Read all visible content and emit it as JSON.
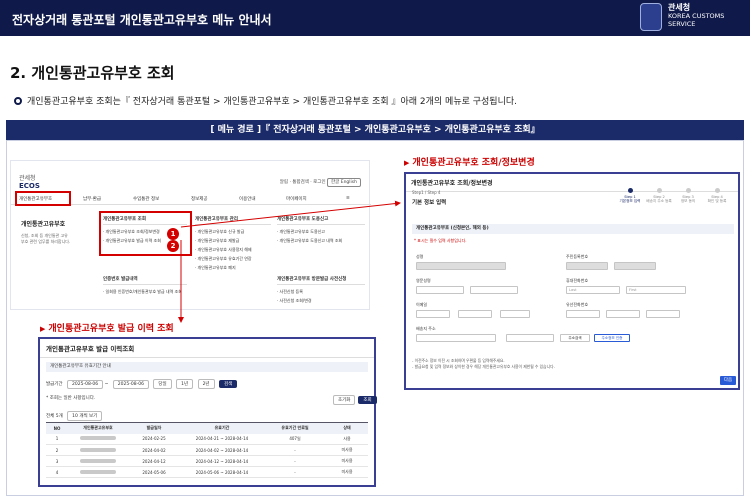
{
  "banner": {
    "title": "전자상거래 통관포털 개인통관고유부호 메뉴 안내서",
    "logo_ko": "관세청",
    "logo_en_1": "KOREA CUSTOMS",
    "logo_en_2": "SERVICE"
  },
  "section": {
    "title": "2. 개인통관고유부호 조회",
    "intro": "개인통관고유부호 조회는『 전자상거래 통관포털 > 개인통관고유부호 > 개인통관고유부호 조회 』아래 2개의 메뉴로 구성됩니다."
  },
  "route": "[ 메뉴 경로 ]『 전자상거래 통관포털 > 개인통관고유부호 > 개인통관고유부호 조회』",
  "ecos": {
    "logo_ko": "관세청",
    "logo_en": "ECOS",
    "util": [
      "알림",
      "통합검색",
      "로그인"
    ],
    "lang": "한글  English",
    "nav": [
      "개인통관고유부호",
      "납부·환급",
      "수입통관 정보",
      "정보제공",
      "이용안내",
      "마이페이지",
      "≡"
    ],
    "side_title": "개인통관고유부호",
    "side_note": "신청, 조회 등 개인통관 고유부호 관련 업무를 처리합니다.",
    "col1_title": "개인통관고유부호 조회",
    "col1_items": [
      "개인통관고유부호 조회/정보변경",
      "개인통관고유부호 발급 이력 조회"
    ],
    "col2_title": "개인통관고유부호 관리",
    "col2_items": [
      "개인통관고유부호 신규 발급",
      "개인통관고유부호 재발급",
      "개인통관고유부호 사용정지 해제",
      "개인통관고유부호 유효기간 연장",
      "개인통관고유부호 폐지"
    ],
    "col3_title": "개인통관고유부호 도용신고",
    "col3_items": [
      "개인통관고유부호 도용신고",
      "개인통관고유부호 도용신고 내역 조회"
    ],
    "col4_title": "인증번호 발급내역",
    "col4_items": [
      "일회용 인증번호/개인통관부호 발급 내역 조회"
    ],
    "col5_title": "개인통관고유부호 방문발급 사전신청",
    "col5_items": [
      "사전신청 등록",
      "사전신청 조회/변경"
    ],
    "badge1": "1",
    "badge2": "2"
  },
  "label_change": "개인통관고유부호 조회/정보변경",
  "label_history": "개인통관고유부호 발급 이력 조회",
  "history": {
    "title": "개인통관고유부호 발급 이력조회",
    "bar": "개인통관고유부호 유효기간 안내",
    "period_label": "발급기간",
    "date_from": "2025-08-06",
    "date_to": "2025-08-06",
    "quick": [
      "당일",
      "1년",
      "2년"
    ],
    "search_btn": "검색",
    "note": "조회는 일반 사항입니다.",
    "reset": "초기화",
    "query": "조회",
    "count": "전체 5개",
    "page_size": "10 개씩 보기",
    "headers": [
      "NO",
      "개인통관고유부호",
      "발급일자",
      "유효기간",
      "유효기간 만료일",
      "상태"
    ],
    "rows": [
      {
        "no": "1",
        "issued": "2024-02-25",
        "valid": "2024-04-21 ~ 2028-04-14",
        "expire": "407일",
        "status": "사용"
      },
      {
        "no": "2",
        "issued": "2024-04-02",
        "valid": "2024-04-02 ~ 2028-04-14",
        "expire": "-",
        "status": "미사용"
      },
      {
        "no": "3",
        "issued": "2024-04-12",
        "valid": "2024-04-12 ~ 2028-04-14",
        "expire": "-",
        "status": "미사용"
      },
      {
        "no": "4",
        "issued": "2024-05-06",
        "valid": "2024-05-06 ~ 2028-04-14",
        "expire": "-",
        "status": "미사용"
      }
    ]
  },
  "change": {
    "title": "개인통관고유부호 조회/정보변경",
    "step_small": "Step1 / Step 4",
    "subtitle": "기본 정보 입력",
    "steps": [
      {
        "n": "Step 1",
        "t": "기본정보 입력"
      },
      {
        "n": "Step 2",
        "t": "배송지 주소 등록"
      },
      {
        "n": "Step 3",
        "t": "정보 동의"
      },
      {
        "n": "Step 4",
        "t": "확인 및 등록"
      }
    ],
    "section_label": "개인통관고유부호 (신청본인, 해외 등)",
    "required_note": "표시는 필수 입력 사항입니다.",
    "fields": {
      "name": "성명",
      "personal": "주민등록번호",
      "eng_name": "영문성명",
      "phone": "휴대전화번호",
      "email": "이메일",
      "landline": "유선전화번호",
      "address": "배송지 주소",
      "last": "Last",
      "first": "First",
      "addr_search": "주소검색",
      "addr_verify": "주소정보 인증"
    },
    "notes": [
      "- 이전주소 정보 이전 시 조회하며 우편물 등 입력해주세요.",
      "- 발급요청 및 입력 정보와 상이한 경우 해당 개인통관고유부호 사용이 제한될 수 있습니다."
    ],
    "next": "다음"
  },
  "colors": {
    "navy": "#0f1a4a",
    "route": "#1b2a68",
    "highlight": "#d40000",
    "window_border": "#3a3f94"
  }
}
